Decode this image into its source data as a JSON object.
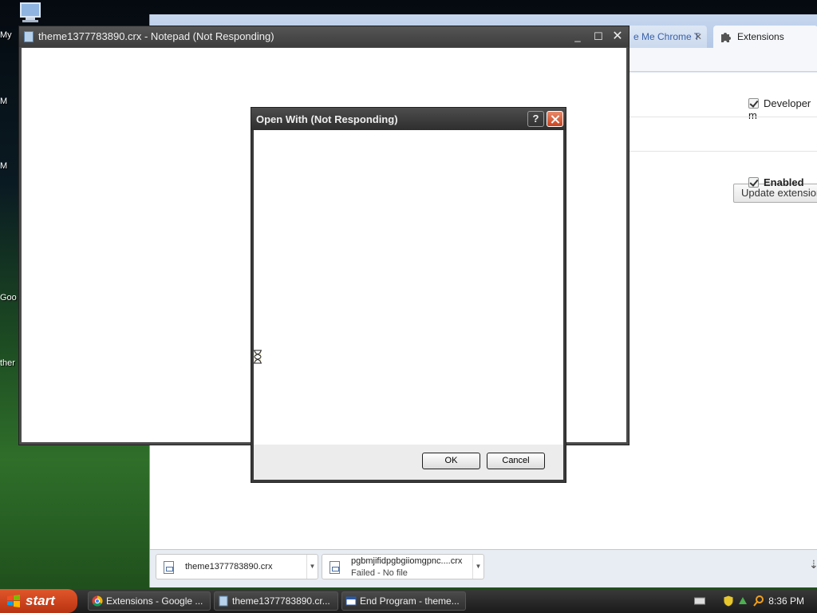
{
  "desktop": {
    "icons": [
      "My",
      "M",
      "M",
      "Goo",
      "ther"
    ]
  },
  "chrome": {
    "tabs": [
      {
        "label": "e Me Chrome T"
      },
      {
        "label": "Extensions"
      }
    ],
    "developer_mode_label": "Developer m",
    "update_button_label": "Update extension",
    "enabled_label": "Enabled",
    "downloads": [
      {
        "name": "theme1377783890.crx",
        "status": ""
      },
      {
        "name": "pgbmjifidpgbgiiomgpnc....crx",
        "status": "Failed - No file"
      }
    ]
  },
  "notepad": {
    "title": "theme1377783890.crx - Notepad (Not Responding)"
  },
  "open_with": {
    "title": "Open With (Not Responding)",
    "help_label": "?",
    "ok_label": "OK",
    "cancel_label": "Cancel"
  },
  "taskbar": {
    "start_label": "start",
    "items": [
      {
        "label": "Extensions - Google ..."
      },
      {
        "label": "theme1377783890.cr..."
      },
      {
        "label": "End Program - theme..."
      }
    ],
    "clock": "8:36 PM"
  },
  "colors": {
    "titlebar_dark": "#3d3d3d",
    "start_orange": "#d04a1f",
    "close_red": "#c9431f",
    "chrome_tab_blue": "#3a62a8"
  },
  "icons": [
    "my-computer-icon",
    "notepad-icon",
    "puzzle-icon",
    "file-icon",
    "help-icon",
    "close-icon",
    "minimize-icon",
    "maximize-icon",
    "hourglass-icon",
    "windows-flag-icon",
    "chrome-icon",
    "shield-icon",
    "keyboard-icon",
    "search-icon"
  ]
}
